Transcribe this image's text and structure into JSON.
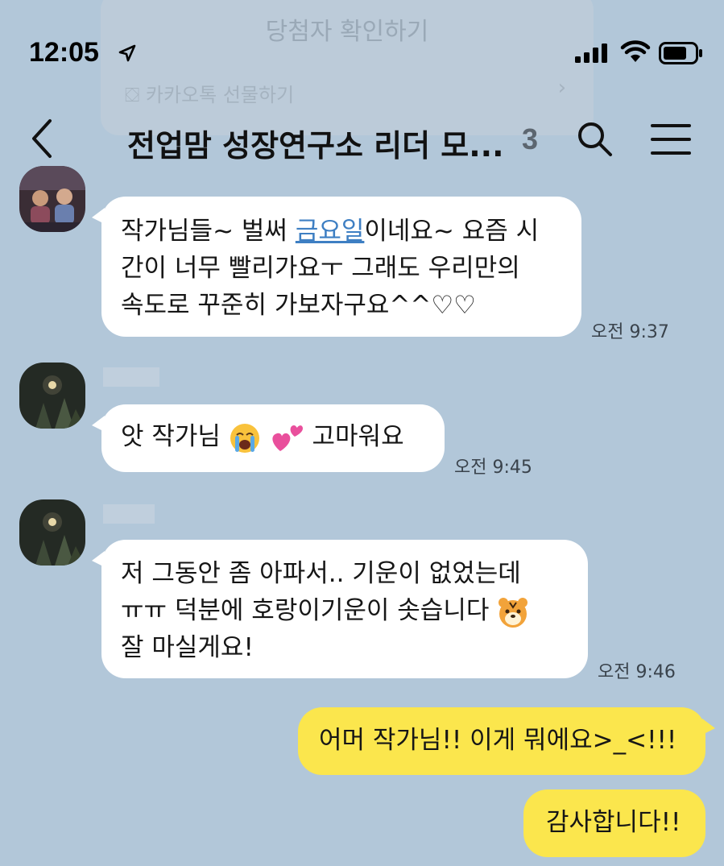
{
  "gift_card": {
    "title": "당첨자 확인하기",
    "link_label": "카카오톡 선물하기"
  },
  "status_bar": {
    "time": "12:05"
  },
  "header": {
    "title": "전업맘 성장연구소 리더 모...",
    "member_count": "3"
  },
  "messages": [
    {
      "sender": "",
      "lines": [
        "작가님들~ 벌써 ",
        "금요일",
        "이네요~ 요즘 시",
        "간이 너무 빨리가요ㅜ 그래도 우리만의",
        "속도로 꾸준히 가보자구요^^♡♡"
      ],
      "time": "오전 9:37"
    },
    {
      "sender": "",
      "lines": [
        "앗 작가님",
        "고마워요"
      ],
      "emoji": [
        "loudly-crying-face",
        "two-hearts"
      ],
      "time": "오전 9:45"
    },
    {
      "sender": "",
      "lines": [
        "저 그동안 좀 아파서.. 기운이 없었는데",
        "ㅠㅠ 덕분에 호랑이기운이 솟습니다",
        "잘 마실게요!"
      ],
      "emoji": [
        "tiger-face"
      ],
      "time": "오전 9:46"
    },
    {
      "mine": true,
      "lines": [
        "어머 작가님!! 이게 뭐에요>_<!!!"
      ]
    },
    {
      "mine": true,
      "lines": [
        "감사합니다!!"
      ]
    }
  ],
  "colors": {
    "background": "#b2c7d9",
    "my_bubble": "#fbe64d",
    "link": "#3e7fc3"
  }
}
